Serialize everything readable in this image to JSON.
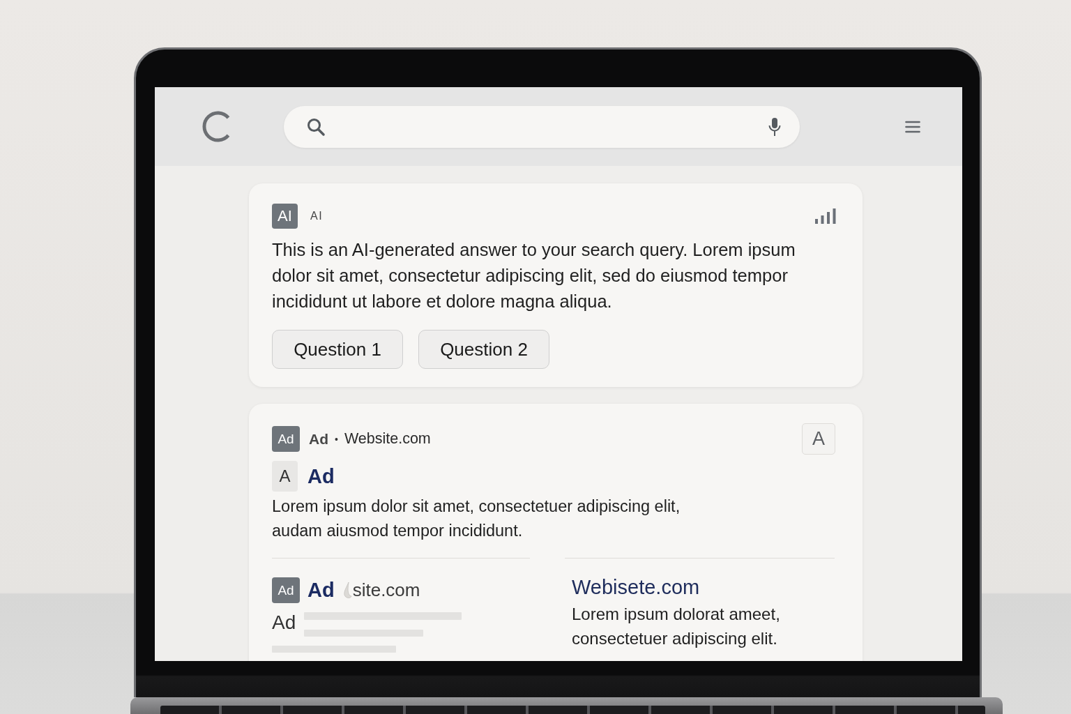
{
  "ai_overview": {
    "badge": "AI",
    "label": "AI",
    "answer": "This is an AI-generated answer to your search query. Lorem ipsum dolor sit amet, consectetur adipiscing elit, sed do eiusmod tempor incididunt ut labore et dolore magna aliqua.",
    "questions": [
      "Question 1",
      "Question 2"
    ]
  },
  "ad_result": {
    "badge": "Ad",
    "sponsor_label": "Ad",
    "separator": "•",
    "domain": "Website.com",
    "corner_letter": "A",
    "avatar_letter": "A",
    "title": "Ad",
    "description": "Lorem ipsum dolor sit amet, consectetuer adipiscing elit, audam aiusmod tempor incididunt."
  },
  "more_results": [
    {
      "kind": "ad",
      "badge": "Ad",
      "title": "Ad",
      "domain": "site.com",
      "label": "Ad"
    },
    {
      "kind": "link",
      "title": "Webisete.com",
      "description": "Lorem ipsum dolorat ameet, consectetuer adipiscing elit."
    }
  ]
}
